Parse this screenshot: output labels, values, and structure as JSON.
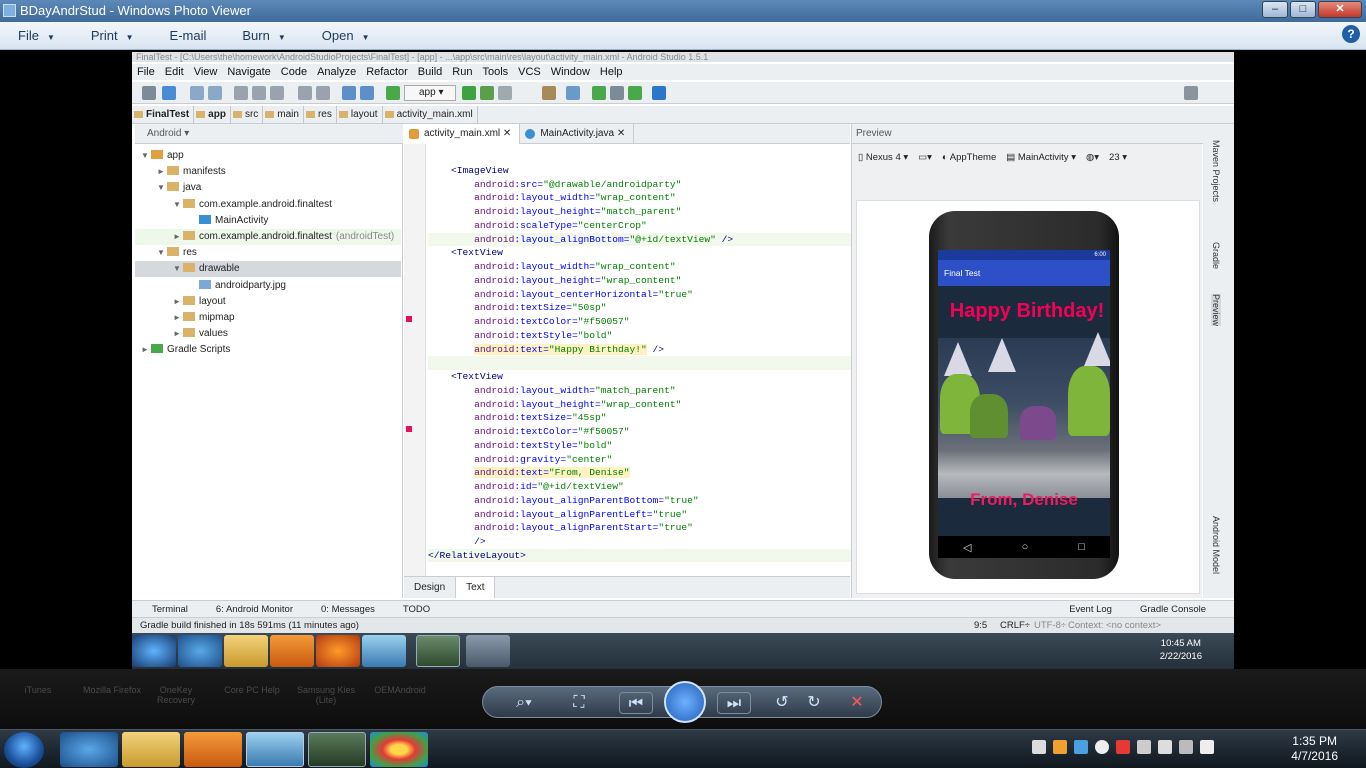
{
  "viewer": {
    "title": "BDayAndrStud - Windows Photo Viewer",
    "menu": [
      "File",
      "Print",
      "E-mail",
      "Burn",
      "Open"
    ],
    "help": "?"
  },
  "studio": {
    "title": "FinalTest - [C:\\Users\\the\\homework\\AndroidStudioProjects\\FinalTest] - [app] - ...\\app\\src\\main\\res\\layout\\activity_main.xml - Android Studio 1.5.1",
    "menu": [
      "File",
      "Edit",
      "View",
      "Navigate",
      "Code",
      "Analyze",
      "Refactor",
      "Build",
      "Run",
      "Tools",
      "VCS",
      "Window",
      "Help"
    ],
    "run_config": "app",
    "breadcrumbs": [
      "FinalTest",
      "app",
      "src",
      "main",
      "res",
      "layout",
      "activity_main.xml"
    ],
    "project_view": "Android",
    "tree": [
      {
        "label": "app",
        "level": 0,
        "arrow": "▼",
        "color": "#e0a040"
      },
      {
        "label": "manifests",
        "level": 1,
        "arrow": "►",
        "color": "#d9b36a"
      },
      {
        "label": "java",
        "level": 1,
        "arrow": "▼",
        "color": "#d9b36a"
      },
      {
        "label": "com.example.android.finaltest",
        "level": 2,
        "arrow": "▼",
        "color": "#d9b36a"
      },
      {
        "label": "MainActivity",
        "level": 3,
        "arrow": "",
        "color": "#3a8fd0"
      },
      {
        "label": "com.example.android.finaltest",
        "suffix": "(androidTest)",
        "level": 2,
        "arrow": "►",
        "color": "#d9b36a"
      },
      {
        "label": "res",
        "level": 1,
        "arrow": "▼",
        "color": "#d9b36a"
      },
      {
        "label": "drawable",
        "level": 2,
        "arrow": "▼",
        "color": "#d9b36a"
      },
      {
        "label": "androidparty.jpg",
        "level": 3,
        "arrow": "",
        "color": "#7aa9d6"
      },
      {
        "label": "layout",
        "level": 2,
        "arrow": "►",
        "color": "#d9b36a"
      },
      {
        "label": "mipmap",
        "level": 2,
        "arrow": "►",
        "color": "#d9b36a"
      },
      {
        "label": "values",
        "level": 2,
        "arrow": "►",
        "color": "#d9b36a"
      },
      {
        "label": "Gradle Scripts",
        "level": 0,
        "arrow": "►",
        "color": "#49a84a"
      }
    ],
    "tabs": [
      "activity_main.xml",
      "MainActivity.java"
    ],
    "bottom_tabs": [
      "Design",
      "Text"
    ],
    "code": [
      [
        [
          "",
          ""
        ]
      ],
      [
        [
          "    ",
          ""
        ],
        [
          "<ImageView",
          "t-tag"
        ]
      ],
      [
        [
          "        ",
          ""
        ],
        [
          "android",
          "t-ns"
        ],
        [
          ":src=",
          "t-at"
        ],
        [
          "\"@drawable/androidparty\"",
          "t-st"
        ]
      ],
      [
        [
          "        ",
          ""
        ],
        [
          "android",
          "t-ns"
        ],
        [
          ":layout_width=",
          "t-at"
        ],
        [
          "\"wrap_content\"",
          "t-st"
        ]
      ],
      [
        [
          "        ",
          ""
        ],
        [
          "android",
          "t-ns"
        ],
        [
          ":layout_height=",
          "t-at"
        ],
        [
          "\"match_parent\"",
          "t-st"
        ]
      ],
      [
        [
          "        ",
          ""
        ],
        [
          "android",
          "t-ns"
        ],
        [
          ":scaleType=",
          "t-at"
        ],
        [
          "\"centerCrop\"",
          "t-st"
        ]
      ],
      [
        [
          "        ",
          ""
        ],
        [
          "android",
          "t-ns"
        ],
        [
          ":layout_alignBottom=",
          "t-at"
        ],
        [
          "\"@+id/textView\"",
          "t-st"
        ],
        [
          " />",
          "t-tag"
        ]
      ],
      [
        [
          "    ",
          ""
        ],
        [
          "<TextView",
          "t-tag"
        ]
      ],
      [
        [
          "        ",
          ""
        ],
        [
          "android",
          "t-ns"
        ],
        [
          ":layout_width=",
          "t-at"
        ],
        [
          "\"wrap_content\"",
          "t-st"
        ]
      ],
      [
        [
          "        ",
          ""
        ],
        [
          "android",
          "t-ns"
        ],
        [
          ":layout_height=",
          "t-at"
        ],
        [
          "\"wrap_content\"",
          "t-st"
        ]
      ],
      [
        [
          "        ",
          ""
        ],
        [
          "android",
          "t-ns"
        ],
        [
          ":layout_centerHorizontal=",
          "t-at"
        ],
        [
          "\"true\"",
          "t-st"
        ]
      ],
      [
        [
          "        ",
          ""
        ],
        [
          "android",
          "t-ns"
        ],
        [
          ":textSize=",
          "t-at"
        ],
        [
          "\"50sp\"",
          "t-st"
        ]
      ],
      [
        [
          "        ",
          ""
        ],
        [
          "android",
          "t-ns"
        ],
        [
          ":textColor=",
          "t-at"
        ],
        [
          "\"#f50057\"",
          "t-st"
        ]
      ],
      [
        [
          "        ",
          ""
        ],
        [
          "android",
          "t-ns"
        ],
        [
          ":textStyle=",
          "t-at"
        ],
        [
          "\"bold\"",
          "t-st"
        ]
      ],
      [
        [
          "        ",
          ""
        ],
        [
          "android",
          "t-ns t-yel"
        ],
        [
          ":text=",
          "t-at t-yel"
        ],
        [
          "\"Happy Birthday!\"",
          "t-st t-yel"
        ],
        [
          " />",
          "t-tag"
        ]
      ],
      [
        [
          "",
          ""
        ]
      ],
      [
        [
          "    ",
          ""
        ],
        [
          "<TextView",
          "t-tag"
        ]
      ],
      [
        [
          "        ",
          ""
        ],
        [
          "android",
          "t-ns"
        ],
        [
          ":layout_width=",
          "t-at"
        ],
        [
          "\"match_parent\"",
          "t-st"
        ]
      ],
      [
        [
          "        ",
          ""
        ],
        [
          "android",
          "t-ns"
        ],
        [
          ":layout_height=",
          "t-at"
        ],
        [
          "\"wrap_content\"",
          "t-st"
        ]
      ],
      [
        [
          "        ",
          ""
        ],
        [
          "android",
          "t-ns"
        ],
        [
          ":textSize=",
          "t-at"
        ],
        [
          "\"45sp\"",
          "t-st"
        ]
      ],
      [
        [
          "        ",
          ""
        ],
        [
          "android",
          "t-ns"
        ],
        [
          ":textColor=",
          "t-at"
        ],
        [
          "\"#f50057\"",
          "t-st"
        ]
      ],
      [
        [
          "        ",
          ""
        ],
        [
          "android",
          "t-ns"
        ],
        [
          ":textStyle=",
          "t-at"
        ],
        [
          "\"bold\"",
          "t-st"
        ]
      ],
      [
        [
          "        ",
          ""
        ],
        [
          "android",
          "t-ns"
        ],
        [
          ":gravity=",
          "t-at"
        ],
        [
          "\"center\"",
          "t-st"
        ]
      ],
      [
        [
          "        ",
          ""
        ],
        [
          "android",
          "t-ns t-yel"
        ],
        [
          ":text=",
          "t-at t-yel"
        ],
        [
          "\"From, Denise\"",
          "t-st t-yel"
        ]
      ],
      [
        [
          "        ",
          ""
        ],
        [
          "android",
          "t-ns"
        ],
        [
          ":id=",
          "t-at"
        ],
        [
          "\"@+id/textView\"",
          "t-st"
        ]
      ],
      [
        [
          "        ",
          ""
        ],
        [
          "android",
          "t-ns"
        ],
        [
          ":layout_alignParentBottom=",
          "t-at"
        ],
        [
          "\"true\"",
          "t-st"
        ]
      ],
      [
        [
          "        ",
          ""
        ],
        [
          "android",
          "t-ns"
        ],
        [
          ":layout_alignParentLeft=",
          "t-at"
        ],
        [
          "\"true\"",
          "t-st"
        ]
      ],
      [
        [
          "        ",
          ""
        ],
        [
          "android",
          "t-ns"
        ],
        [
          ":layout_alignParentStart=",
          "t-at"
        ],
        [
          "\"true\"",
          "t-st"
        ]
      ],
      [
        [
          "        ",
          ""
        ],
        [
          "/>",
          "t-tag"
        ]
      ],
      [
        [
          "",
          ""
        ],
        [
          "</RelativeLayout>",
          "t-tag"
        ]
      ]
    ],
    "preview": {
      "title": "Preview",
      "device": "Nexus 4",
      "theme": "AppTheme",
      "activity": "MainActivity",
      "api": "23",
      "phone_time": "6:00",
      "app_title": "Final Test",
      "happy": "Happy Birthday!",
      "from": "From, Denise"
    },
    "right_tools": [
      "Maven Projects",
      "Gradle",
      "Preview",
      "Android Model"
    ],
    "bottom_tools": [
      "Terminal",
      "6: Android Monitor",
      "0: Messages",
      "TODO"
    ],
    "bottom_right_tools": [
      "Event Log",
      "Gradle Console"
    ],
    "status": "Gradle build finished in 18s 591ms (11 minutes ago)",
    "status_right": [
      "9:5",
      "CRLF÷",
      "UTF-8÷",
      "Context: <no context>"
    ],
    "inner_clock_time": "10:45 AM",
    "inner_clock_date": "2/22/2016"
  },
  "desktop_labels": [
    "iTunes",
    "Mozilla Firefox",
    "OneKey Recovery",
    "Core PC Help",
    "Samsung Kies (Lite)",
    "OEMAndroid"
  ],
  "taskbar": {
    "time": "1:35 PM",
    "date": "4/7/2016"
  },
  "colors": {
    "accent": "#f50057",
    "actionbar": "#2d50c9"
  }
}
